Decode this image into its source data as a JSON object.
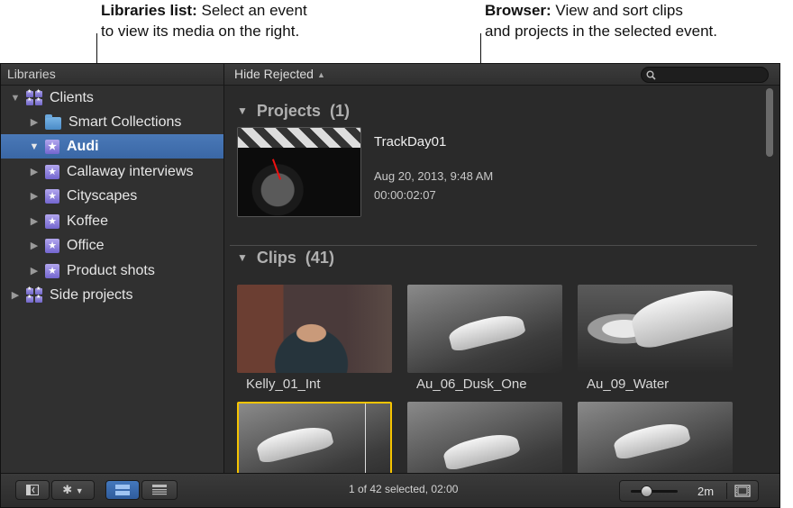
{
  "callouts": {
    "left_bold": "Libraries list:",
    "left_rest": " Select an event",
    "left_line2": "to view its media on the right.",
    "right_bold": "Browser:",
    "right_rest": " View and sort clips",
    "right_line2": "and projects in the selected event."
  },
  "libraries": {
    "header": "Libraries",
    "items": [
      {
        "label": "Clients",
        "type": "library",
        "expanded": true,
        "level": 0,
        "selected": false
      },
      {
        "label": "Smart Collections",
        "type": "folder",
        "expanded": false,
        "level": 1,
        "selected": false
      },
      {
        "label": "Audi",
        "type": "event",
        "expanded": true,
        "level": 1,
        "selected": true
      },
      {
        "label": "Callaway interviews",
        "type": "event",
        "expanded": false,
        "level": 1,
        "selected": false
      },
      {
        "label": "Cityscapes",
        "type": "event",
        "expanded": false,
        "level": 1,
        "selected": false
      },
      {
        "label": "Koffee",
        "type": "event",
        "expanded": false,
        "level": 1,
        "selected": false
      },
      {
        "label": "Office",
        "type": "event",
        "expanded": false,
        "level": 1,
        "selected": false
      },
      {
        "label": "Product shots",
        "type": "event",
        "expanded": false,
        "level": 1,
        "selected": false
      },
      {
        "label": "Side projects",
        "type": "library",
        "expanded": false,
        "level": 0,
        "selected": false
      }
    ]
  },
  "toolbar": {
    "filter_label": "Hide Rejected",
    "search_placeholder": ""
  },
  "browser": {
    "projects_label": "Projects",
    "projects_count": "(1)",
    "project": {
      "title": "TrackDay01",
      "date": "Aug 20, 2013, 9:48 AM",
      "duration": "00:00:02:07"
    },
    "clips_label": "Clips",
    "clips_count": "(41)",
    "clips": [
      {
        "name": "Kelly_01_Int",
        "selected": false
      },
      {
        "name": "Au_06_Dusk_One",
        "selected": false
      },
      {
        "name": "Au_09_Water",
        "selected": false
      },
      {
        "name": "",
        "selected": true
      },
      {
        "name": "",
        "selected": false
      },
      {
        "name": "",
        "selected": false
      }
    ]
  },
  "bottombar": {
    "status": "1 of 42 selected, 02:00",
    "zoom_label": "2m",
    "zoom_level": 0.35
  },
  "colors": {
    "selection": "#3f6fae",
    "window_bg": "#2b2b2b",
    "accent_yellow": "#f6c400"
  },
  "icons": {
    "library": "library-icon",
    "event": "event-icon",
    "folder": "folder-icon",
    "search": "search-icon",
    "gear": "gear-icon",
    "filmstrip": "filmstrip-icon"
  }
}
